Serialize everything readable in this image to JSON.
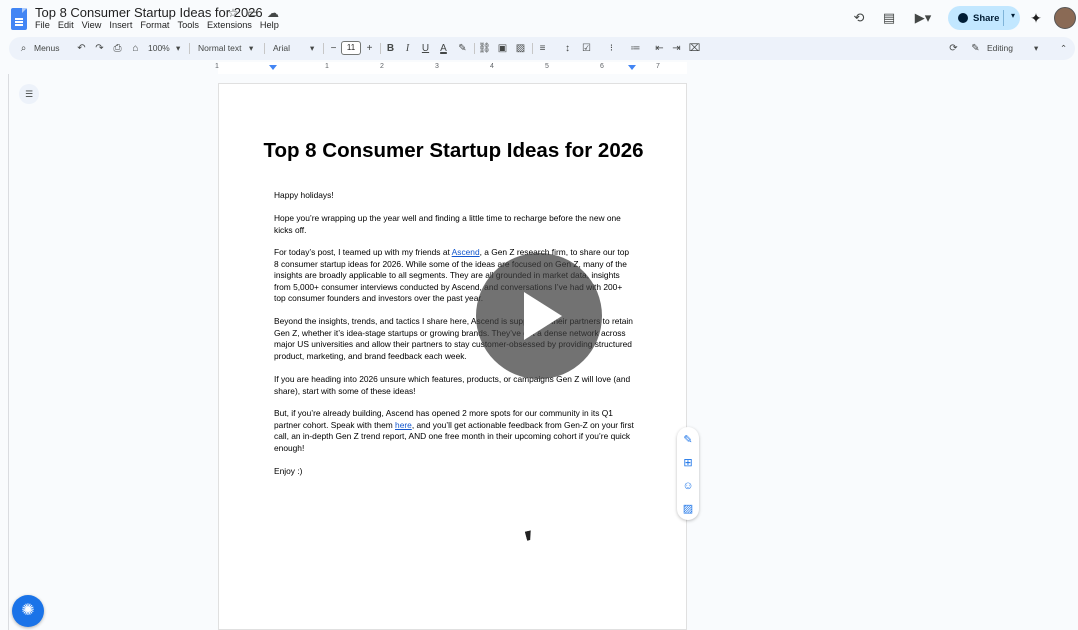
{
  "titlebar": {
    "doc_title": "Top 8 Consumer Startup Ideas for 2026",
    "menu": [
      "File",
      "Edit",
      "View",
      "Insert",
      "Format",
      "Tools",
      "Extensions",
      "Help"
    ],
    "share_label": "Share"
  },
  "toolbar": {
    "menus_label": "Menus",
    "zoom": "100%",
    "style": "Normal text",
    "font": "Arial",
    "font_size": "11",
    "mode": "Editing"
  },
  "ruler": {
    "labels": [
      "1",
      "1",
      "2",
      "3",
      "4",
      "5",
      "6",
      "7"
    ]
  },
  "document": {
    "heading": "Top 8 Consumer Startup Ideas for 2026",
    "p1": "Happy holidays!",
    "p2": "Hope you’re wrapping up the year well and finding a little time to recharge before the new one kicks off.",
    "p3_a": "For today’s post, I teamed up with my friends at ",
    "p3_link": "Ascend",
    "p3_b": ", a Gen Z research firm, to share our top 8 consumer startup ideas for 2026. While some of the ideas are focused on Gen Z, many of the insights are broadly applicable to all segments. They are all grounded in market data, insights from 5,000+ consumer interviews conducted by Ascend, and conversations I’ve had with 200+ top consumer founders and investors over the past year.",
    "p4": "Beyond the insights, trends, and tactics I share here, Ascend is supporting their partners to retain Gen Z, whether it’s idea-stage startups or growing brands. They’ve got a dense network across major US universities and allow their partners to stay customer-obsessed by providing structured product, marketing, and brand feedback each week.",
    "p5": "If you are heading into 2026 unsure which features, products, or campaigns Gen Z will love (and share), start with some of these ideas!",
    "p6_a": "But, if you’re already building, Ascend has opened 2 more spots for our community in its Q1 partner cohort. Speak with them ",
    "p6_link": "here",
    "p6_b": ", and you’ll get actionable feedback from Gen-Z on your first call, an in-depth Gen Z trend report, AND one free month in their upcoming cohort if you’re quick enough!",
    "p7": "Enjoy :)"
  },
  "colors": {
    "accent": "#1a73e8",
    "share_bg": "#c2e7ff",
    "toolbar_bg": "#edf2fa",
    "link": "#1155cc"
  },
  "icons": [
    "docs-logo-icon",
    "star-icon",
    "folder-icon",
    "cloud-icon",
    "history-icon",
    "comment-icon",
    "video-call-icon",
    "globe-icon",
    "gemini-icon",
    "play-icon",
    "help-icon"
  ]
}
